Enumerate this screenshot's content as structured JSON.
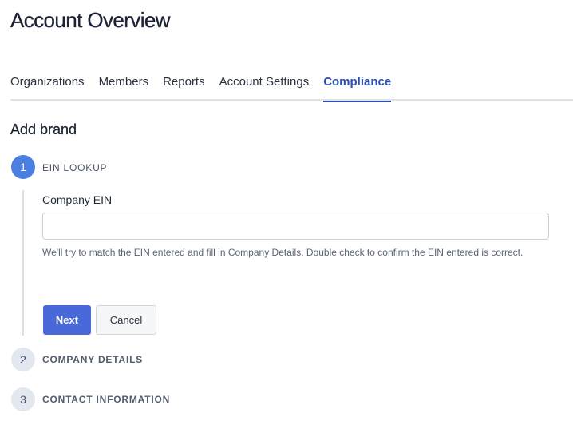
{
  "page": {
    "title": "Account Overview"
  },
  "tabs": [
    {
      "label": "Organizations",
      "active": false
    },
    {
      "label": "Members",
      "active": false
    },
    {
      "label": "Reports",
      "active": false
    },
    {
      "label": "Account Settings",
      "active": false
    },
    {
      "label": "Compliance",
      "active": true
    }
  ],
  "section": {
    "title": "Add brand"
  },
  "steps": [
    {
      "number": "1",
      "label": "EIN LOOKUP",
      "state": "active"
    },
    {
      "number": "2",
      "label": "COMPANY DETAILS",
      "state": "inactive"
    },
    {
      "number": "3",
      "label": "CONTACT INFORMATION",
      "state": "inactive"
    }
  ],
  "form": {
    "ein_label": "Company EIN",
    "ein_value": "",
    "ein_placeholder": "",
    "help_text": "We'll try to match the EIN entered and fill in Company Details. Double check to confirm the EIN entered is correct.",
    "next_label": "Next",
    "cancel_label": "Cancel"
  },
  "colors": {
    "accent": "#2b4fb3",
    "primary_button": "#4a69d8",
    "active_step": "#4a7ee0",
    "inactive_step": "#e3e7ef"
  }
}
